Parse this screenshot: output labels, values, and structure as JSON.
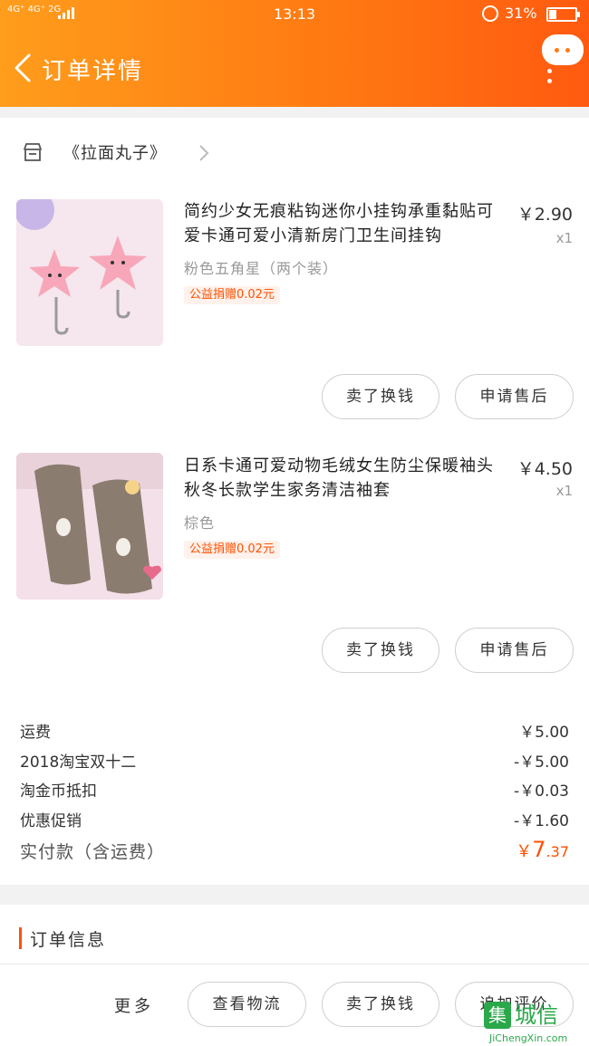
{
  "status_bar": {
    "network": "4G⁺ 4G⁺ 2G",
    "time": "13:13",
    "battery": "31%"
  },
  "header": {
    "title": "订单详情",
    "back_icon": "chevron-left-icon",
    "chat_icon": "chat-bubble-icon",
    "more_icon": "more-vertical-icon"
  },
  "shop": {
    "icon": "store-icon",
    "name": "《拉面丸子》"
  },
  "products": [
    {
      "title": "简约少女无痕粘钩迷你小挂钩承重黏贴可爱卡通可爱小清新房门卫生间挂钩",
      "price": "￥2.90",
      "qty": "x1",
      "sku": "粉色五角星（两个装）",
      "tag": "公益捐赠0.02元",
      "btn_resell": "卖了换钱",
      "btn_after_sale": "申请售后"
    },
    {
      "title": "日系卡通可爱动物毛绒女生防尘保暖袖头秋冬长款学生家务清洁袖套",
      "price": "￥4.50",
      "qty": "x1",
      "sku": "棕色",
      "tag": "公益捐赠0.02元",
      "btn_resell": "卖了换钱",
      "btn_after_sale": "申请售后"
    }
  ],
  "fees": [
    {
      "label": "运费",
      "value": "￥5.00"
    },
    {
      "label": "2018淘宝双十二",
      "value": "-￥5.00"
    },
    {
      "label": "淘金币抵扣",
      "value": "-￥0.03"
    },
    {
      "label": "优惠促销",
      "value": "-￥1.60"
    }
  ],
  "total": {
    "label": "实付款（含运费）",
    "currency": "￥",
    "integer": "7",
    "decimal": ".37"
  },
  "order_info": {
    "title": "订单信息"
  },
  "footer": {
    "more": "更多",
    "btn_logistics": "查看物流",
    "btn_resell": "卖了换钱",
    "btn_review": "追加评价"
  },
  "watermark": {
    "cn": "城信",
    "en": "JiChengXin.com"
  },
  "colors": {
    "accent": "#ff5000",
    "header_start": "#ff9d1c",
    "header_end": "#ff5a10"
  }
}
